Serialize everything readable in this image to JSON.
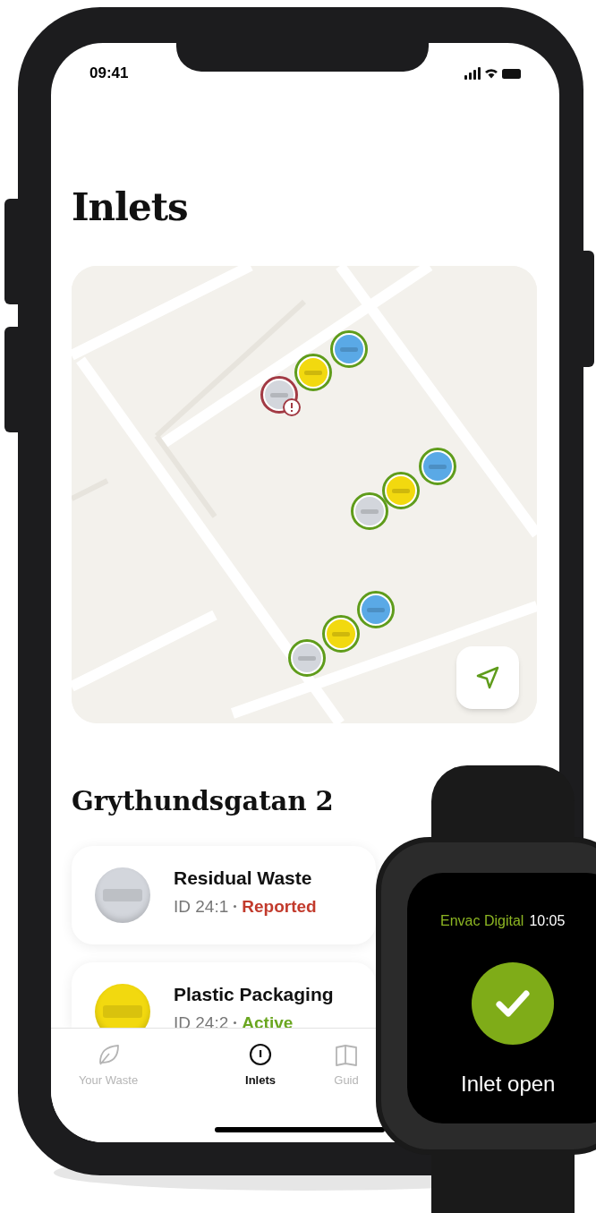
{
  "status_bar": {
    "time": "09:41"
  },
  "title": "Inlets",
  "map": {
    "markers": [
      {
        "color": "#d3d6dc",
        "kind": "reported"
      },
      {
        "color": "#f2d90f",
        "kind": "active"
      },
      {
        "color": "#5aa9e6",
        "kind": "active"
      },
      {
        "color": "#d3d6dc",
        "kind": "active"
      },
      {
        "color": "#f2d90f",
        "kind": "active"
      },
      {
        "color": "#5aa9e6",
        "kind": "active"
      },
      {
        "color": "#d3d6dc",
        "kind": "active"
      },
      {
        "color": "#f2d90f",
        "kind": "active"
      },
      {
        "color": "#5aa9e6",
        "kind": "active"
      }
    ]
  },
  "section_title": "Grythundsgatan 2",
  "inlets": [
    {
      "name": "Residual Waste",
      "id": "ID 24:1",
      "status": "Reported",
      "kind": "reported",
      "color": "#d3d6dc"
    },
    {
      "name": "Plastic Packaging",
      "id": "ID 24:2",
      "status": "Active",
      "kind": "active",
      "color": "#f2d90f"
    }
  ],
  "tabs": [
    {
      "label": "Your Waste",
      "selected": false
    },
    {
      "label": "Inlets",
      "selected": true
    },
    {
      "label": "Guid",
      "selected": false
    }
  ],
  "watch": {
    "app": "Envac Digital",
    "time": "10:05",
    "message": "Inlet open"
  }
}
